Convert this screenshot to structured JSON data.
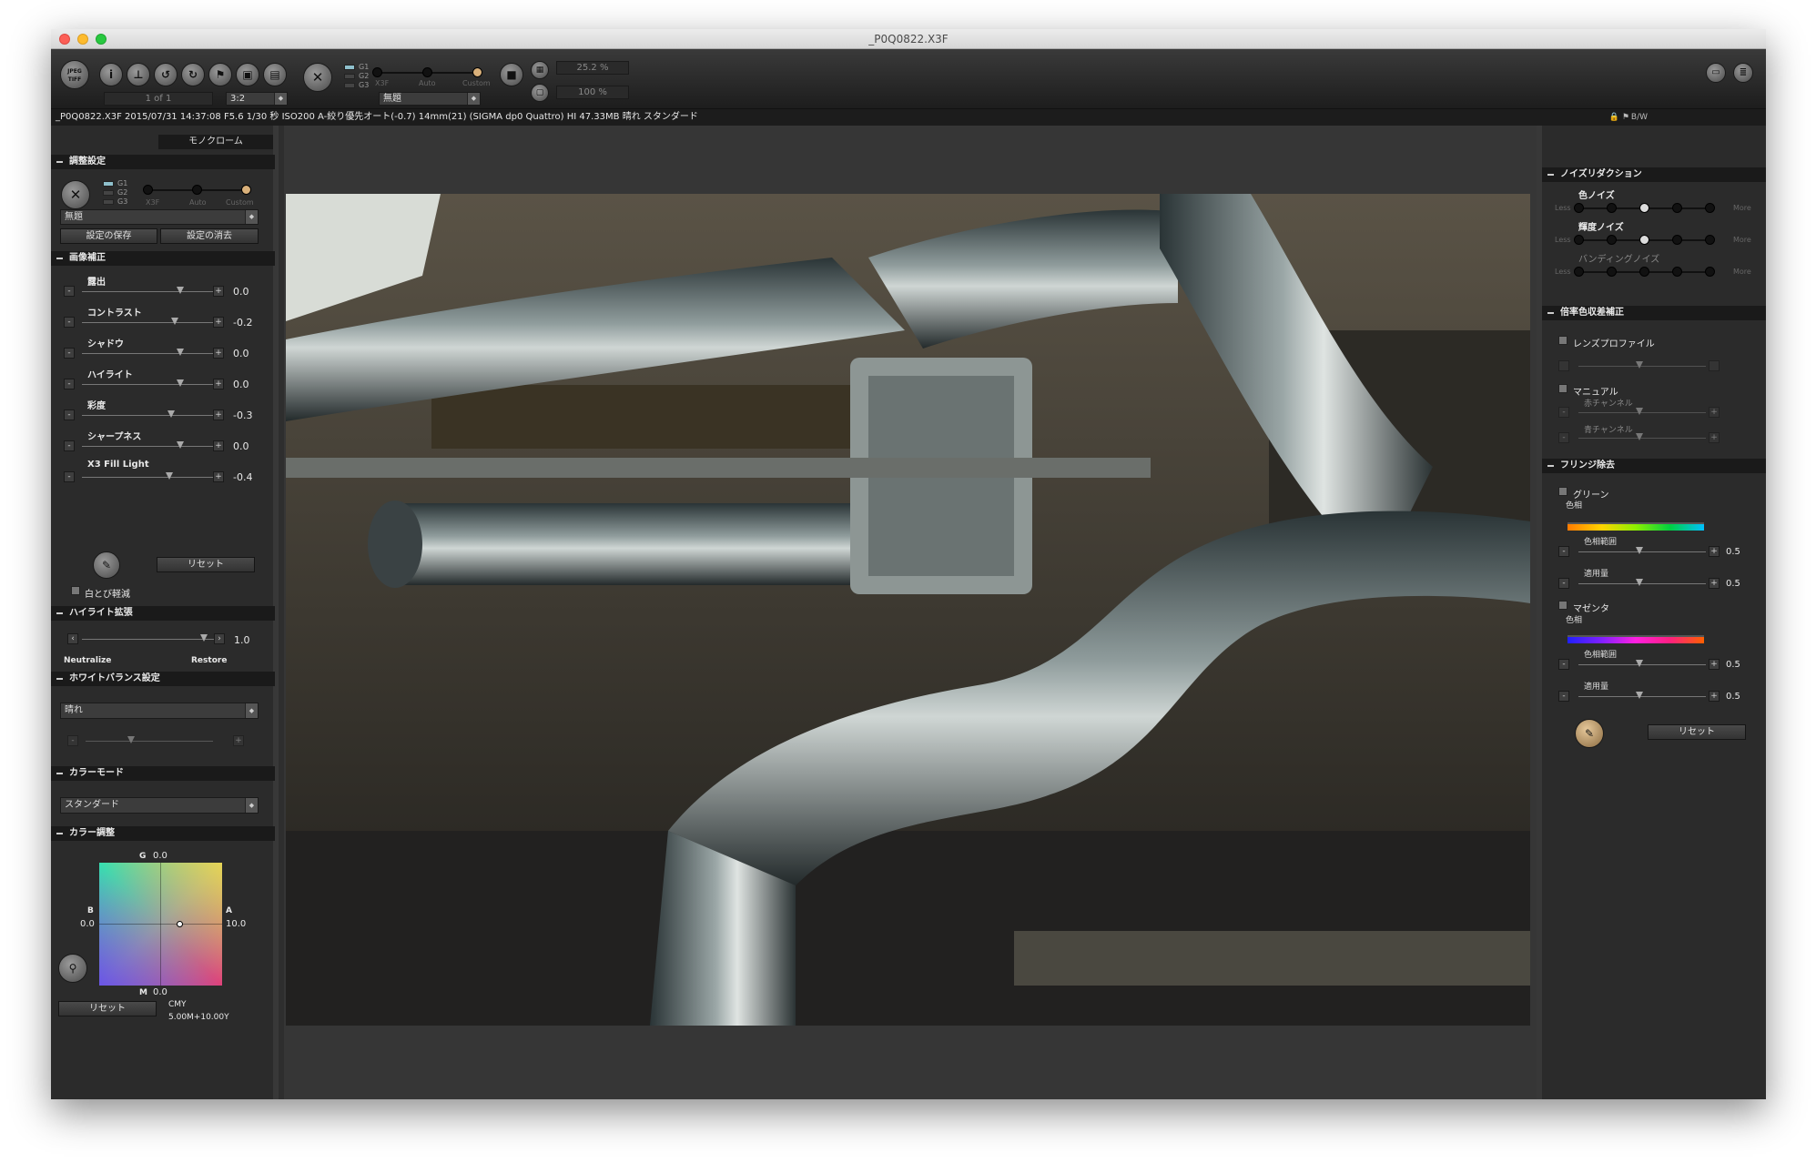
{
  "window": {
    "title": "_P0Q0822.X3F"
  },
  "toolbar": {
    "jpeg_tiff": "JPEG TIFF",
    "page_label": "1 of 1",
    "aspect": "3:2",
    "gbuttons": [
      "G1",
      "G2",
      "G3"
    ],
    "slider_labels": [
      "X3F",
      "Auto",
      "Custom"
    ],
    "preset": "無題",
    "zoom1": "25.2 %",
    "zoom2": "100 %"
  },
  "info": "_P0Q0822.X3F 2015/07/31 14:37:08 F5.6 1/30 秒 ISO200 A-絞り優先オート(-0.7) 14mm(21) (SIGMA dp0 Quattro) HI 47.33MB 晴れ スタンダード",
  "info_right": "B/W",
  "left": {
    "mode_tab": "モノクローム",
    "s_adjust": "調整設定",
    "preset": "無題",
    "save": "設定の保存",
    "erase": "設定の消去",
    "s_correct": "画像補正",
    "sliders": [
      {
        "label": "露出",
        "value": "0.0",
        "pos": 0.5
      },
      {
        "label": "コントラスト",
        "value": "-0.2",
        "pos": 0.45
      },
      {
        "label": "シャドウ",
        "value": "0.0",
        "pos": 0.5
      },
      {
        "label": "ハイライト",
        "value": "0.0",
        "pos": 0.5
      },
      {
        "label": "彩度",
        "value": "-0.3",
        "pos": 0.42
      },
      {
        "label": "シャープネス",
        "value": "0.0",
        "pos": 0.5
      },
      {
        "label": "X3 Fill Light",
        "value": "-0.4",
        "pos": 0.4
      }
    ],
    "reset": "リセット",
    "clip": "白とび軽減",
    "s_highlight": "ハイライト拡張",
    "hl_value": "1.0",
    "neutralize": "Neutralize",
    "restore": "Restore",
    "s_wb": "ホワイトバランス設定",
    "wb": "晴れ",
    "s_colormode": "カラーモード",
    "colormode": "スタンダード",
    "s_coloradj": "カラー調整",
    "g": "G",
    "g_val": "0.0",
    "b": "B",
    "b_val": "0.0",
    "a": "A",
    "a_val": "10.0",
    "m": "M",
    "m_val": "0.0",
    "cmy": "CMY",
    "cmy_val": "5.00M+10.00Y",
    "reset2": "リセット"
  },
  "right": {
    "s_noise": "ノイズリダクション",
    "noise": [
      {
        "label": "色ノイズ",
        "pos": 2
      },
      {
        "label": "輝度ノイズ",
        "pos": 2
      },
      {
        "label": "バンディングノイズ",
        "pos": -1
      }
    ],
    "less": "Less",
    "more": "More",
    "s_chroma": "倍率色収差補正",
    "lens": "レンズプロファイル",
    "manual": "マニュアル",
    "red": "赤チャンネル",
    "blue": "青チャンネル",
    "s_fringe": "フリンジ除去",
    "green": "グリーン",
    "hue": "色相",
    "range": "色相範囲",
    "amount": "適用量",
    "magenta": "マゼンタ",
    "v05": "0.5",
    "reset": "リセット"
  }
}
